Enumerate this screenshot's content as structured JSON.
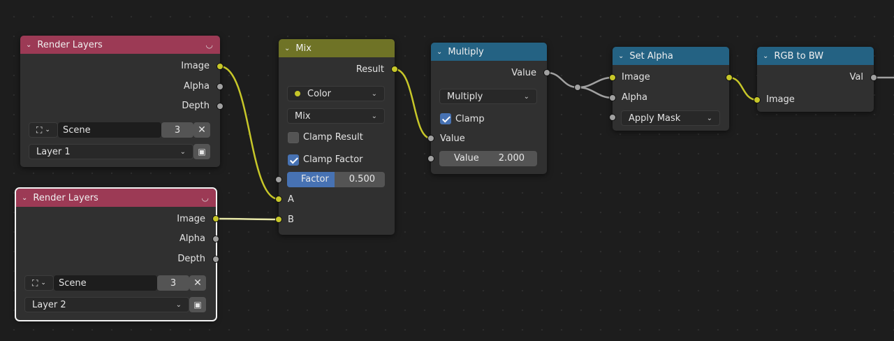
{
  "colors": {
    "render_layers_header": "#9c3a55",
    "mix_header": "#6f7326",
    "converter_header": "#246283",
    "socket_color": "#c7c729",
    "socket_value": "#a1a1a1",
    "accent_blue": "#4772b3"
  },
  "render_layers_1": {
    "title": "Render Layers",
    "outputs": {
      "image": "Image",
      "alpha": "Alpha",
      "depth": "Depth"
    },
    "scene_name": "Scene",
    "user_count": "3",
    "unlink_icon": "✕",
    "layer": "Layer 1",
    "icons": {
      "scene": "scene-data-icon",
      "render": "render-layer-icon"
    }
  },
  "render_layers_2": {
    "title": "Render Layers",
    "outputs": {
      "image": "Image",
      "alpha": "Alpha",
      "depth": "Depth"
    },
    "scene_name": "Scene",
    "user_count": "3",
    "unlink_icon": "✕",
    "layer": "Layer 2",
    "selected": true
  },
  "mix": {
    "title": "Mix",
    "output": "Result",
    "data_type": "Color",
    "blend_mode": "Mix",
    "clamp_result_label": "Clamp Result",
    "clamp_result": false,
    "clamp_factor_label": "Clamp Factor",
    "clamp_factor": true,
    "factor_label": "Factor",
    "factor_value": "0.500",
    "factor": 0.5,
    "input_a": "A",
    "input_b": "B"
  },
  "multiply": {
    "title": "Multiply",
    "output": "Value",
    "operation": "Multiply",
    "clamp_label": "Clamp",
    "clamp": true,
    "input_value": "Value",
    "value_label": "Value",
    "value": "2.000"
  },
  "set_alpha": {
    "title": "Set Alpha",
    "input_image": "Image",
    "input_alpha": "Alpha",
    "mode": "Apply Mask"
  },
  "rgb_to_bw": {
    "title": "RGB to BW",
    "output": "Val",
    "input_image": "Image"
  },
  "glyphs": {
    "chevron_down": "⌄",
    "collapse": "⌄",
    "hide": "◡"
  }
}
